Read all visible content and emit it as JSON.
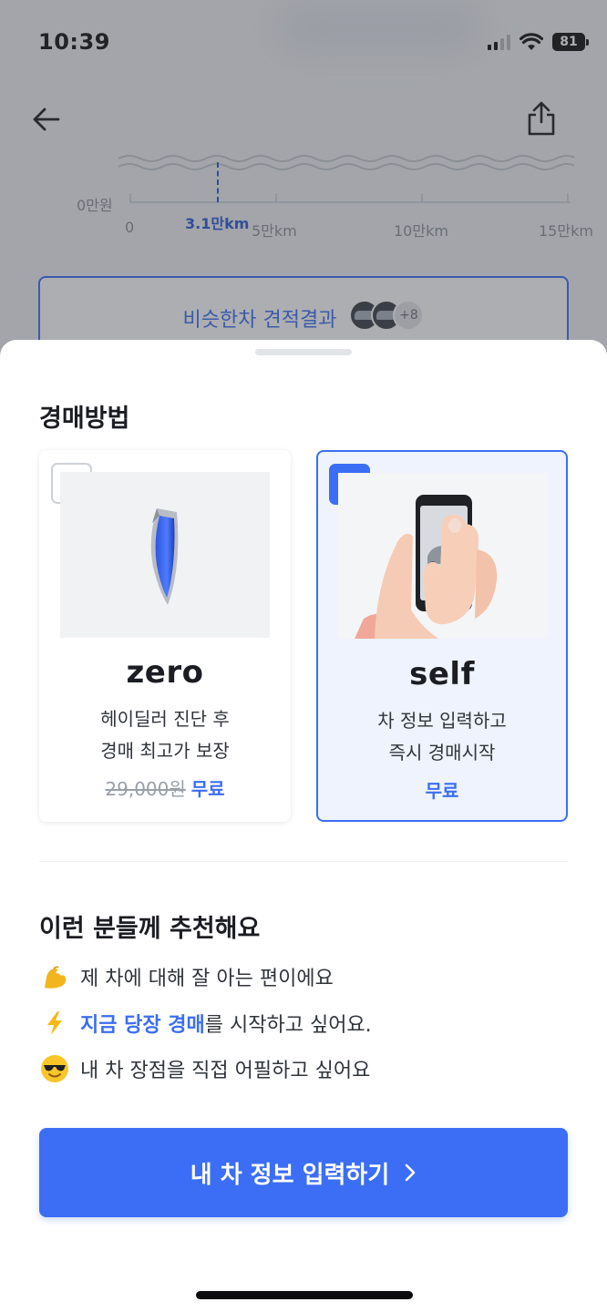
{
  "status_bar": {
    "time": "10:39",
    "battery": "81"
  },
  "background": {
    "chart_data": {
      "type": "line",
      "ylabel_min": "0만원",
      "x_ticks": [
        "0",
        "5만km",
        "10만km",
        "15만km"
      ],
      "marker": {
        "label": "3.1만km",
        "value": 3.1
      }
    },
    "similar_button": {
      "label": "비슷한차 견적결과",
      "more_count": "+8"
    }
  },
  "sheet": {
    "title": "경매방법",
    "options": [
      {
        "name": "zero",
        "desc_line1": "헤이딜러 진단 후",
        "desc_line2": "경매 최고가 보장",
        "old_price": "29,000원",
        "price": "무료",
        "selected": false
      },
      {
        "name": "self",
        "desc_line1": "차 정보 입력하고",
        "desc_line2": "즉시 경매시작",
        "price": "무료",
        "selected": true
      }
    ],
    "recommend_title": "이런 분들께 추천해요",
    "recommend_items": [
      {
        "icon": "flexed-biceps-icon",
        "text": "제 차에 대해 잘 아는 편이에요"
      },
      {
        "icon": "lightning-icon",
        "highlight": "지금 당장 경매",
        "text": "를 시작하고 싶어요."
      },
      {
        "icon": "sunglasses-face-icon",
        "text": "내 차 장점을 직접 어필하고 싶어요"
      }
    ],
    "cta_label": "내 차 정보 입력하기"
  },
  "colors": {
    "accent": "#3b6ef5",
    "selected_bg": "#eef3fe",
    "overlay": "rgba(60,62,68,0.42)"
  }
}
